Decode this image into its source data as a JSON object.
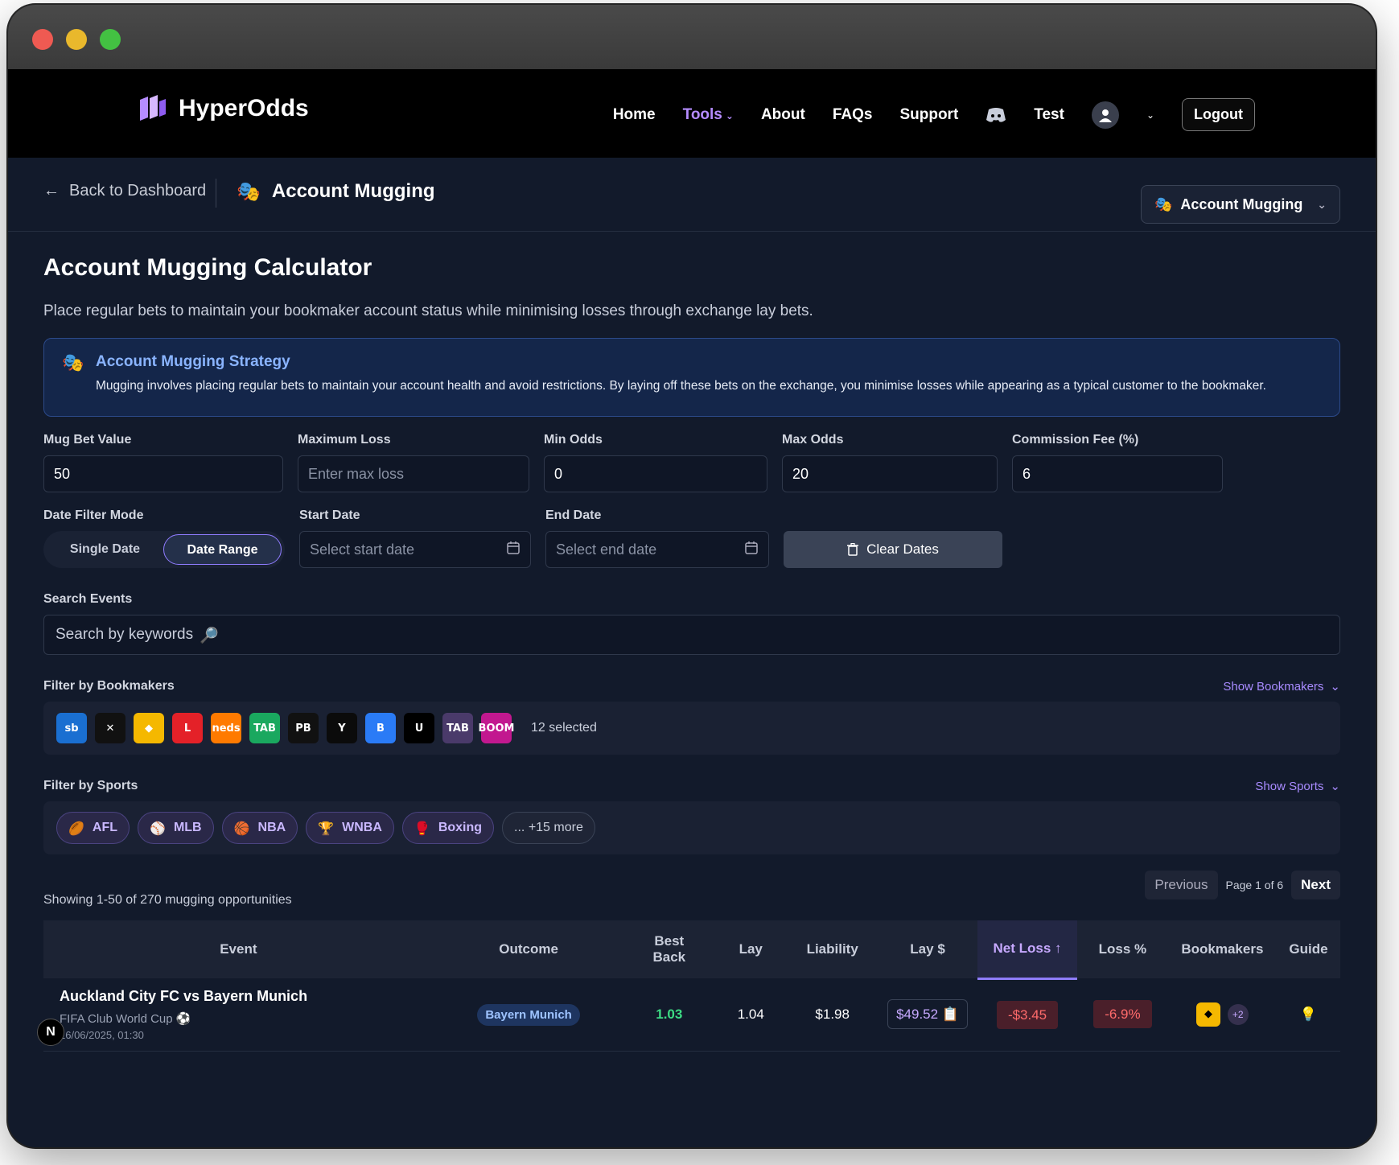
{
  "nav": {
    "brand": "HyperOdds",
    "home": "Home",
    "tools": "Tools",
    "about": "About",
    "faqs": "FAQs",
    "support": "Support",
    "user": "Test",
    "logout": "Logout"
  },
  "subheader": {
    "back": "Back to Dashboard",
    "title": "Account Mugging",
    "tool_select": "Account Mugging"
  },
  "page": {
    "title": "Account Mugging Calculator",
    "lead": "Place regular bets to maintain your bookmaker account status while minimising losses through exchange lay bets."
  },
  "info": {
    "title": "Account Mugging Strategy",
    "body": "Mugging involves placing regular bets to maintain your account health and avoid restrictions. By laying off these bets on the exchange, you minimise losses while appearing as a typical customer to the bookmaker."
  },
  "fields": {
    "mug_label": "Mug Bet Value",
    "mug_value": "50",
    "maxloss_label": "Maximum Loss",
    "maxloss_placeholder": "Enter max loss",
    "minodds_label": "Min Odds",
    "minodds_value": "0",
    "maxodds_label": "Max Odds",
    "maxodds_value": "20",
    "comm_label": "Commission Fee (%)",
    "comm_value": "6"
  },
  "dates": {
    "mode_label": "Date Filter Mode",
    "single": "Single Date",
    "range": "Date Range",
    "start_label": "Start Date",
    "start_placeholder": "Select start date",
    "end_label": "End Date",
    "end_placeholder": "Select end date",
    "clear": "Clear Dates"
  },
  "search": {
    "label": "Search Events",
    "placeholder": "Search by keywords"
  },
  "bookmakers": {
    "label": "Filter by Bookmakers",
    "toggle": "Show Bookmakers",
    "selected": "12 selected",
    "items": [
      {
        "text": "sb",
        "color": "#1a6fd1"
      },
      {
        "text": "✕",
        "color": "#111111"
      },
      {
        "text": "◆",
        "color": "#f5b800"
      },
      {
        "text": "L",
        "color": "#e42128"
      },
      {
        "text": "neds",
        "color": "#ff7a00"
      },
      {
        "text": "TAB",
        "color": "#1aa85f"
      },
      {
        "text": "PB",
        "color": "#111111"
      },
      {
        "text": "Y",
        "color": "#0b0b0b"
      },
      {
        "text": "B",
        "color": "#2a7bf6"
      },
      {
        "text": "U",
        "color": "#000000"
      },
      {
        "text": "TAB",
        "color": "#4a3a6a"
      },
      {
        "text": "BOOM",
        "color": "#c2188f"
      }
    ]
  },
  "sports": {
    "label": "Filter by Sports",
    "toggle": "Show Sports",
    "items": [
      {
        "icon": "🏉",
        "label": "AFL"
      },
      {
        "icon": "⚾",
        "label": "MLB"
      },
      {
        "icon": "🏀",
        "label": "NBA"
      },
      {
        "icon": "🏆",
        "label": "WNBA"
      },
      {
        "icon": "🥊",
        "label": "Boxing"
      }
    ],
    "more": "... +15 more"
  },
  "pager": {
    "prev": "Previous",
    "page": "Page 1 of 6",
    "next": "Next"
  },
  "showing": "Showing 1-50 of 270 mugging opportunities",
  "table": {
    "headers": {
      "event": "Event",
      "outcome": "Outcome",
      "best_back_1": "Best",
      "best_back_2": "Back",
      "lay": "Lay",
      "liability": "Liability",
      "lay_amt": "Lay $",
      "net_loss": "Net Loss ↑",
      "loss_pct": "Loss %",
      "bookmakers": "Bookmakers",
      "guide": "Guide"
    },
    "row": {
      "event": "Auckland City FC vs Bayern Munich",
      "comp": "FIFA Club World Cup",
      "date": "16/06/2025, 01:30",
      "outcome": "Bayern Munich",
      "back": "1.03",
      "lay": "1.04",
      "liability": "$1.98",
      "lay_amt": "$49.52",
      "net_loss": "-$3.45",
      "loss_pct": "-6.9%",
      "more_bm": "+2"
    }
  },
  "badge": "N"
}
